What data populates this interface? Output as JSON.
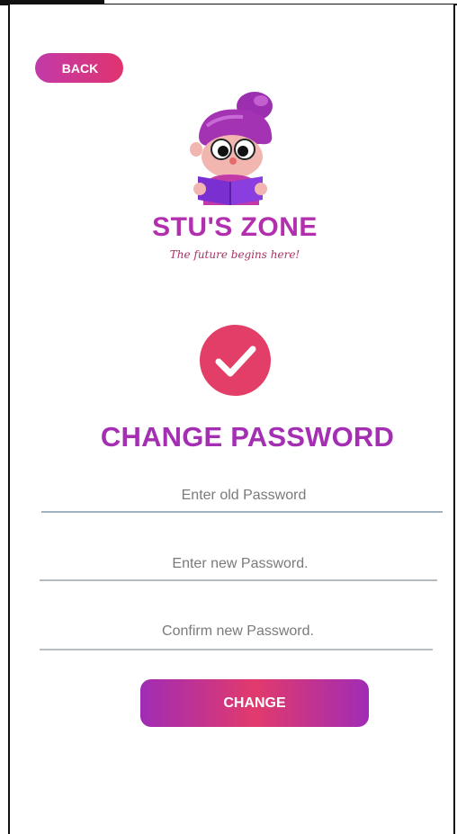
{
  "header": {
    "back_label": "BACK"
  },
  "brand": {
    "name": "STU'S ZONE",
    "tagline": "The future begins here!"
  },
  "form": {
    "title": "CHANGE PASSWORD",
    "old_password_placeholder": "Enter old Password",
    "new_password_placeholder": "Enter new Password.",
    "confirm_password_placeholder": "Confirm new Password.",
    "submit_label": "CHANGE"
  },
  "icons": {
    "logo": "reading-child-mascot-icon",
    "status": "checkmark-icon"
  },
  "colors": {
    "brand_purple": "#a42fb2",
    "accent_pink": "#e23e68",
    "field_line": "#a9b4bd"
  }
}
